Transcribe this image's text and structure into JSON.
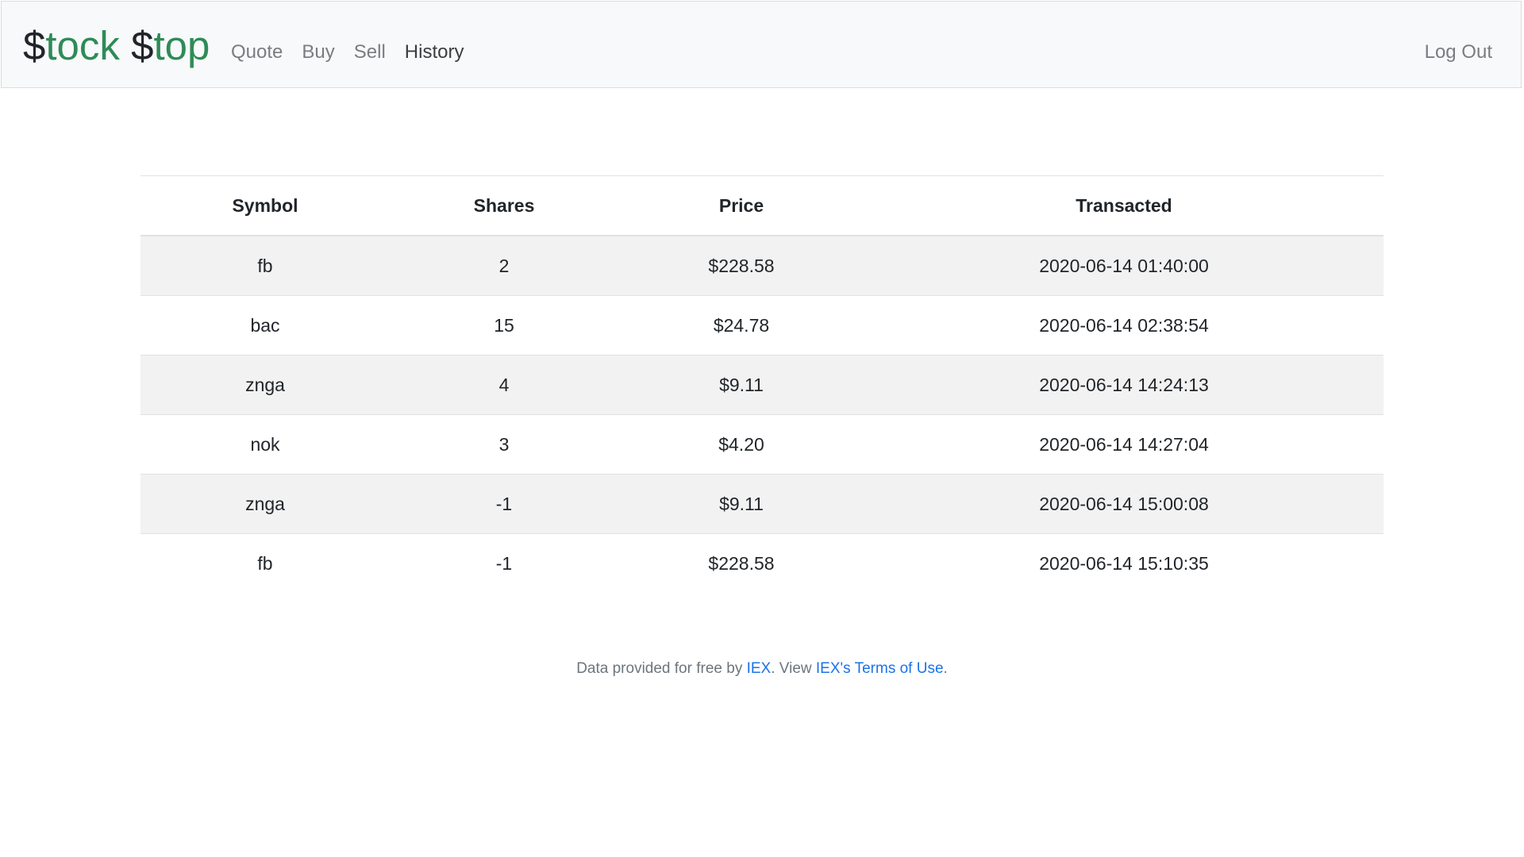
{
  "navbar": {
    "brand": {
      "part1_symbol": "$",
      "part1_word": "tock",
      "part2_symbol": "$",
      "part2_word": "top"
    },
    "links": [
      {
        "label": "Quote"
      },
      {
        "label": "Buy"
      },
      {
        "label": "Sell"
      },
      {
        "label": "History"
      }
    ],
    "logout_label": "Log Out"
  },
  "table": {
    "headers": {
      "symbol": "Symbol",
      "shares": "Shares",
      "price": "Price",
      "transacted": "Transacted"
    },
    "rows": [
      {
        "symbol": "fb",
        "shares": "2",
        "price": "$228.58",
        "transacted": "2020-06-14 01:40:00"
      },
      {
        "symbol": "bac",
        "shares": "15",
        "price": "$24.78",
        "transacted": "2020-06-14 02:38:54"
      },
      {
        "symbol": "znga",
        "shares": "4",
        "price": "$9.11",
        "transacted": "2020-06-14 14:24:13"
      },
      {
        "symbol": "nok",
        "shares": "3",
        "price": "$4.20",
        "transacted": "2020-06-14 14:27:04"
      },
      {
        "symbol": "znga",
        "shares": "-1",
        "price": "$9.11",
        "transacted": "2020-06-14 15:00:08"
      },
      {
        "symbol": "fb",
        "shares": "-1",
        "price": "$228.58",
        "transacted": "2020-06-14 15:10:35"
      }
    ]
  },
  "footer": {
    "text_before": "Data provided for free by ",
    "iex_link": "IEX",
    "text_middle": ". View ",
    "terms_link": "IEX's Terms of Use",
    "text_after": "."
  },
  "colors": {
    "brand_green": "#2e8b57",
    "link_blue": "#1a73e8",
    "nav_muted": "#7a7d80",
    "navbar_bg": "#f8f9fa",
    "stripe_bg": "#f2f2f2"
  }
}
